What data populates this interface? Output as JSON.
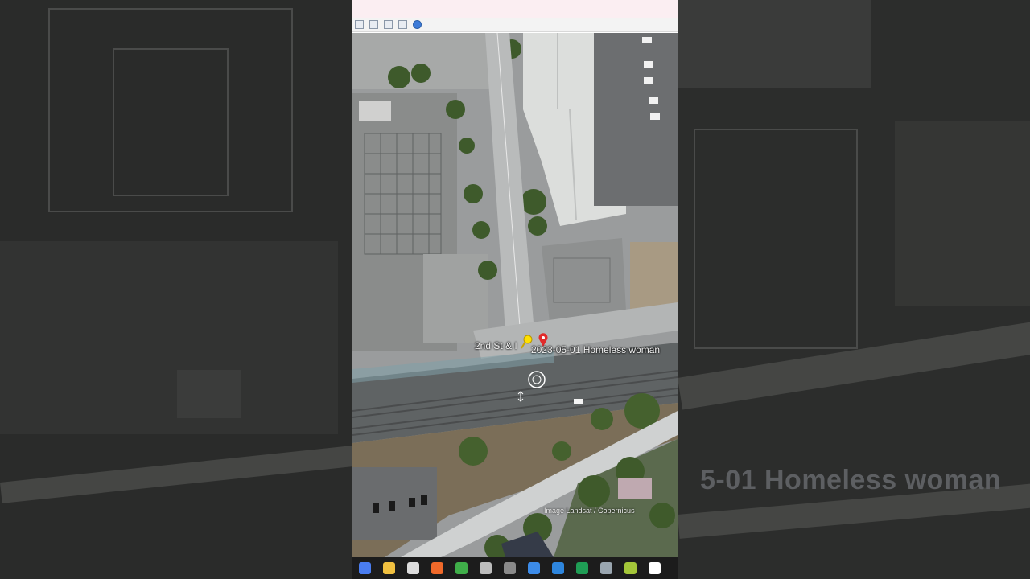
{
  "map": {
    "placemark_label": "2023-05-01 Homeless woman",
    "street_label": "2nd St & I",
    "attribution": "Image Landsat / Copernicus"
  },
  "background": {
    "ghost_text": "5-01 Homeless woman"
  },
  "toolbar": {
    "buttons": [
      "rect-select-icon",
      "print-icon",
      "save-image-icon",
      "view-image-icon",
      "globe-icon"
    ]
  },
  "taskbar": {
    "apps": [
      {
        "name": "zoom-icon",
        "color": "#4a7df0"
      },
      {
        "name": "file-explorer-icon",
        "color": "#f0c040"
      },
      {
        "name": "store-icon",
        "color": "#dcdcdc"
      },
      {
        "name": "firefox-icon",
        "color": "#f0692a"
      },
      {
        "name": "chrome-icon",
        "color": "#3fae49"
      },
      {
        "name": "app-icon",
        "color": "#bdbdbd"
      },
      {
        "name": "media-icon",
        "color": "#8a8a8a"
      },
      {
        "name": "notepad-icon",
        "color": "#3c8be8"
      },
      {
        "name": "s-app-icon",
        "color": "#2e86de"
      },
      {
        "name": "excel-icon",
        "color": "#1f9d55"
      },
      {
        "name": "google-earth-icon",
        "color": "#9aa6b0"
      },
      {
        "name": "android-icon",
        "color": "#a4c639"
      },
      {
        "name": "arrow-app-icon",
        "color": "#ffffff"
      }
    ]
  }
}
